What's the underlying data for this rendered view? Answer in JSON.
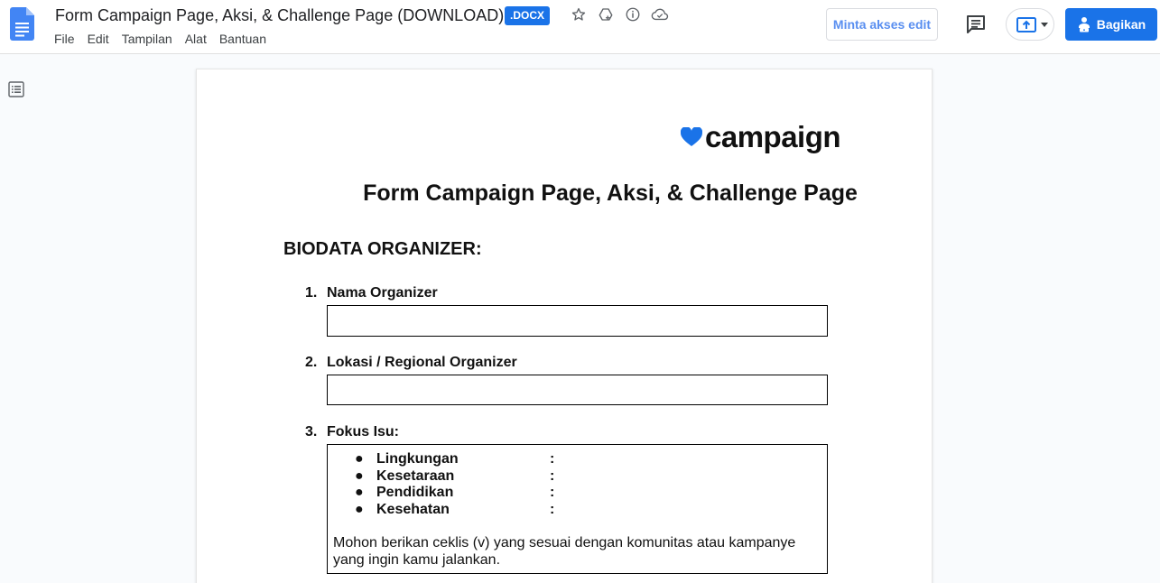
{
  "header": {
    "title": "Form Campaign Page, Aksi, & Challenge Page (DOWNLOAD)",
    "badge": ".DOCX",
    "menu": [
      "File",
      "Edit",
      "Tampilan",
      "Alat",
      "Bantuan"
    ],
    "request_edit_label": "Minta akses edit",
    "share_label": "Bagikan"
  },
  "colors": {
    "accent": "#1a73e8",
    "logo_heart": "#1a73e8"
  },
  "document": {
    "logo_text": "campaign",
    "title": "Form Campaign Page, Aksi, & Challenge Page",
    "section_heading": "BIODATA ORGANIZER:",
    "questions": [
      {
        "number": "1.",
        "label": "Nama Organizer"
      },
      {
        "number": "2.",
        "label": "Lokasi / Regional Organizer"
      },
      {
        "number": "3.",
        "label": "Fokus Isu:"
      }
    ],
    "focus_options": [
      {
        "label": "Lingkungan",
        "value": ":"
      },
      {
        "label": "Kesetaraan",
        "value": ":"
      },
      {
        "label": "Pendidikan",
        "value": ":"
      },
      {
        "label": "Kesehatan",
        "value": ":"
      }
    ],
    "focus_note": "Mohon berikan ceklis (v) yang sesuai dengan komunitas atau kampanye yang ingin kamu jalankan."
  }
}
